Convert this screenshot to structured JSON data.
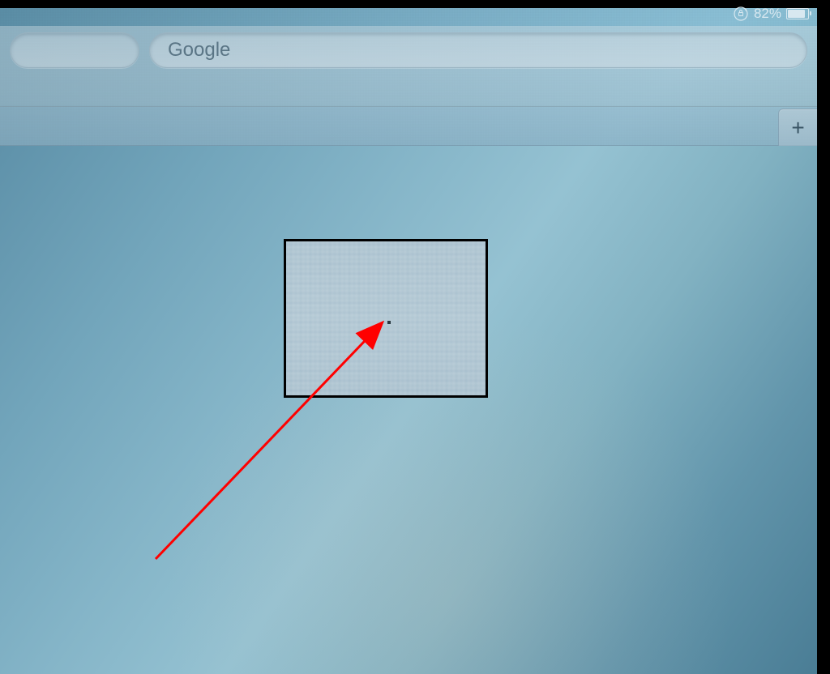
{
  "status_bar": {
    "battery_percent": "82%",
    "rotation_lock_icon": "rotation-lock",
    "battery_icon": "battery"
  },
  "toolbar": {
    "search_placeholder": "Google"
  },
  "tab_bar": {
    "new_tab_label": "+"
  },
  "annotation": {
    "arrow_color": "#ff0000",
    "box_border": "#000000"
  }
}
